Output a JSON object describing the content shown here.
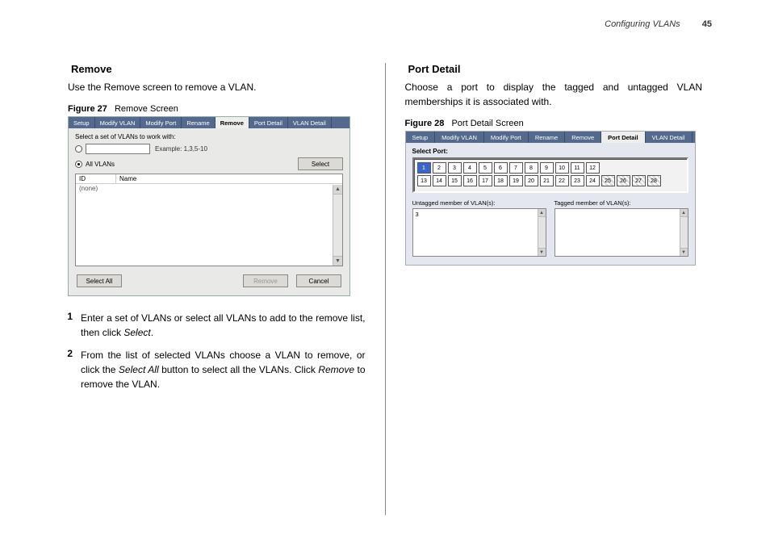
{
  "header": {
    "section": "Configuring VLANs",
    "page_number": "45"
  },
  "left": {
    "heading": "Remove",
    "intro": "Use the Remove screen to remove a VLAN.",
    "figure_label": "Figure 27",
    "figure_title": "Remove Screen",
    "tabs": [
      "Setup",
      "Modify VLAN",
      "Modify Port",
      "Rename",
      "Remove",
      "Port Detail",
      "VLAN Detail"
    ],
    "active_tab": "Remove",
    "select_prompt": "Select a set of VLANs to work with:",
    "example_text": "Example: 1,3,5-10",
    "all_label": "All VLANs",
    "select_btn": "Select",
    "col_id": "ID",
    "col_name": "Name",
    "none_row": "(none)",
    "select_all_btn": "Select All",
    "remove_btn": "Remove",
    "cancel_btn": "Cancel",
    "steps": [
      {
        "num": "1",
        "text_before": "Enter a set of VLANs or select all VLANs to add to the remove list, then click ",
        "em1": "Select",
        "after1": "."
      },
      {
        "num": "2",
        "text_before": "From the list of selected VLANs choose a VLAN to remove, or click the ",
        "em1": "Select All",
        "mid": " button to select all the VLANs. Click ",
        "em2": "Remove",
        "after2": " to remove the VLAN."
      }
    ]
  },
  "right": {
    "heading": "Port Detail",
    "intro": "Choose a port to display the tagged and untagged VLAN memberships it is associated with.",
    "figure_label": "Figure 28",
    "figure_title": "Port Detail Screen",
    "tabs": [
      "Setup",
      "Modify VLAN",
      "Modify Port",
      "Rename",
      "Remove",
      "Port Detail",
      "VLAN Detail"
    ],
    "active_tab": "Port Detail",
    "select_port_label": "Select Port:",
    "ports_row1": [
      "1",
      "2",
      "3",
      "4",
      "5",
      "6",
      "7",
      "8",
      "9",
      "10",
      "11",
      "12"
    ],
    "ports_row2": [
      "13",
      "14",
      "15",
      "16",
      "17",
      "18",
      "19",
      "20",
      "21",
      "22",
      "23",
      "24",
      "25",
      "26",
      "27",
      "28"
    ],
    "hashed_ports": [
      "25",
      "26",
      "27",
      "28"
    ],
    "selected_port": "1",
    "untagged_label": "Untagged member of VLAN(s):",
    "tagged_label": "Tagged member of VLAN(s):",
    "untagged_value": "3"
  }
}
